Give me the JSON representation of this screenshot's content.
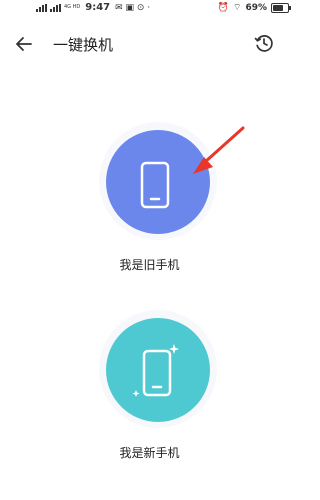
{
  "status_bar": {
    "network_label": "4G HD",
    "time": "9:47",
    "battery_percent_text": "69%",
    "battery_level": 0.69
  },
  "header": {
    "title": "一键换机"
  },
  "options": {
    "old_phone_label": "我是旧手机",
    "new_phone_label": "我是新手机"
  },
  "colors": {
    "old_phone_circle": "#6b87ec",
    "new_phone_circle": "#4fc9d1",
    "annotation_arrow": "#e8362a"
  },
  "icons": {
    "back": "arrow-left-icon",
    "history": "clock-history-icon",
    "old_phone": "smartphone-icon",
    "new_phone": "smartphone-sparkle-icon"
  }
}
